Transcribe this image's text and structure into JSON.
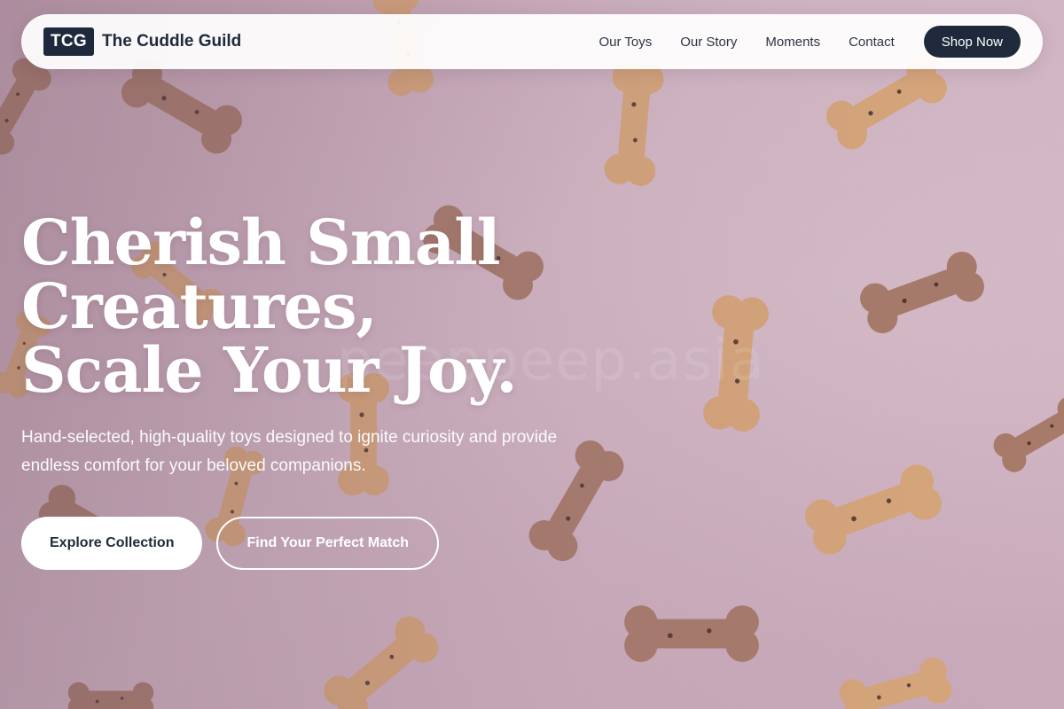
{
  "brand": {
    "logo": "TCG",
    "name": "The Cuddle Guild"
  },
  "nav": {
    "links": [
      "Our Toys",
      "Our Story",
      "Moments",
      "Contact"
    ],
    "cta": "Shop Now"
  },
  "hero": {
    "headline": "Cherish Small Creatures, Scale Your Joy.",
    "subtext": "Hand-selected, high-quality toys designed to ignite curiosity and provide endless comfort for your beloved companions.",
    "primary_button": "Explore Collection",
    "secondary_button": "Find Your Perfect Match",
    "watermark": "peeppeep.asia",
    "background_image": "pink background with scattered dog biscuit bones"
  },
  "colors": {
    "navy": "#1e2a3b",
    "background": "#cdaebd",
    "biscuit_light": "#d7a679",
    "biscuit_dark": "#a77a69"
  }
}
